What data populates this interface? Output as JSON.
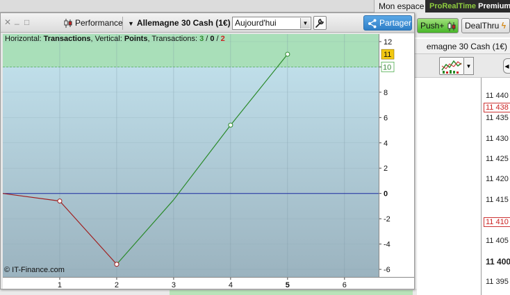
{
  "background_app": {
    "my_space_label": "Mon espace",
    "brand_part1": "ProRealTime",
    "brand_part2": "Premium",
    "push_label": "Push+",
    "dealthru_label": "DealThru",
    "instrument_title_partial": "emagne 30 Cash (1€)",
    "price_labels": [
      {
        "text": "11 440",
        "style": "normal"
      },
      {
        "text": "11 438",
        "style": "highlight"
      },
      {
        "text": "11 435",
        "style": "normal"
      },
      {
        "text": "11 430",
        "style": "normal"
      },
      {
        "text": "11 425",
        "style": "normal"
      },
      {
        "text": "11 420",
        "style": "normal"
      },
      {
        "text": "11 415",
        "style": "normal"
      },
      {
        "text": "11 410",
        "style": "highlight"
      },
      {
        "text": "11 405",
        "style": "normal"
      },
      {
        "text": "11 400",
        "style": "bold"
      },
      {
        "text": "11 395",
        "style": "normal"
      }
    ]
  },
  "perf_window": {
    "window_controls": {
      "close": "✕",
      "minimize": "_",
      "maximize": "□"
    },
    "menu_label": "Performance",
    "instrument": "Allemagne 30 Cash (1€)",
    "period": "Aujourd'hui",
    "share_label": "Partager",
    "header": {
      "horizontal_label": "Horizontal:",
      "horizontal_value": "Transactions",
      "vertical_label": "Vertical:",
      "vertical_value": "Points",
      "transactions_label": "Transactions:",
      "wins": "3",
      "flat": "0",
      "losses": "2",
      "sep": " / "
    },
    "copyright": "© IT-Finance.com"
  },
  "chart_data": {
    "type": "line",
    "x": [
      0,
      1,
      2,
      3,
      4,
      5
    ],
    "y": [
      0,
      -0.6,
      -5.6,
      -0.5,
      5.4,
      11
    ],
    "point_markers_at": [
      1,
      2,
      4,
      5
    ],
    "segment_colors": [
      "#a01e1e",
      "#a01e1e",
      "#2a8a2a",
      "#2a8a2a",
      "#2a8a2a"
    ],
    "zero_line_color": "#1a2aa0",
    "xlim": [
      0,
      6.6
    ],
    "ylim": [
      -6.6,
      12.6
    ],
    "x_ticks": [
      "1",
      "2",
      "3",
      "4",
      "5",
      "6"
    ],
    "x_bold_tick": "5",
    "y_ticks": [
      "12",
      "10",
      "8",
      "6",
      "4",
      "2",
      "0",
      "-2",
      "-4",
      "-6"
    ],
    "y_bold_tick": "0",
    "last_value_label": "11",
    "target_line_value": 10,
    "target_line_label": "10",
    "green_zone_from": 10,
    "colors": {
      "zone_green": "#a9dfb9",
      "area_top": "#c5e5f0",
      "area_bottom": "#9bb3bf",
      "last_value_bg": "#f2c811"
    }
  }
}
